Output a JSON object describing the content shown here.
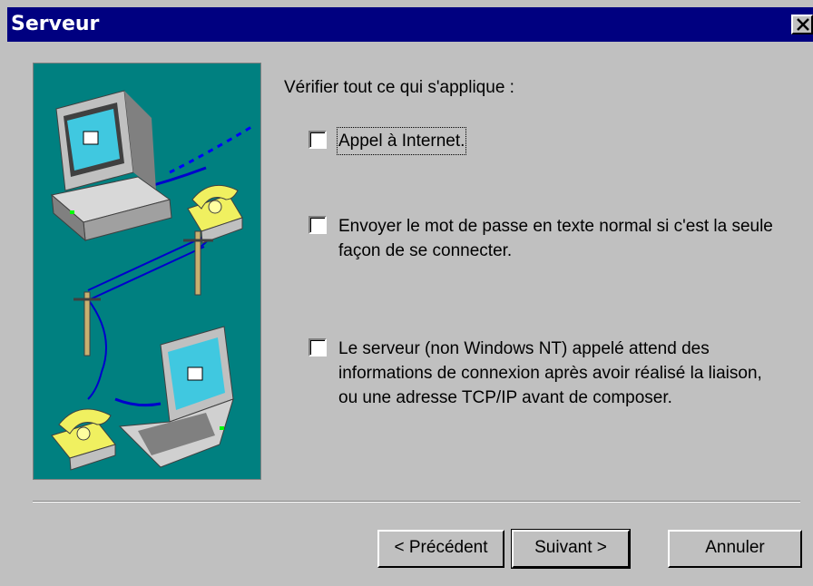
{
  "window": {
    "title": "Serveur"
  },
  "prompt": "Vérifier tout ce qui s'applique :",
  "options": [
    {
      "label": "Appel à Internet.",
      "checked": false
    },
    {
      "label": "Envoyer le mot de passe en texte normal si c'est la seule façon de se connecter.",
      "checked": false
    },
    {
      "label": "Le serveur (non Windows NT) appelé attend des informations de connexion après avoir réalisé la liaison, ou une adresse TCP/IP avant de composer.",
      "checked": false
    }
  ],
  "buttons": {
    "back": "< Précédent",
    "next": "Suivant >",
    "cancel": "Annuler"
  },
  "colors": {
    "titlebar": "#000080",
    "face": "#c0c0c0",
    "illustration_bg": "#008080"
  },
  "icons": [
    "close-icon",
    "computer-icon",
    "telephone-icon",
    "utility-pole-icon",
    "laptop-icon"
  ]
}
